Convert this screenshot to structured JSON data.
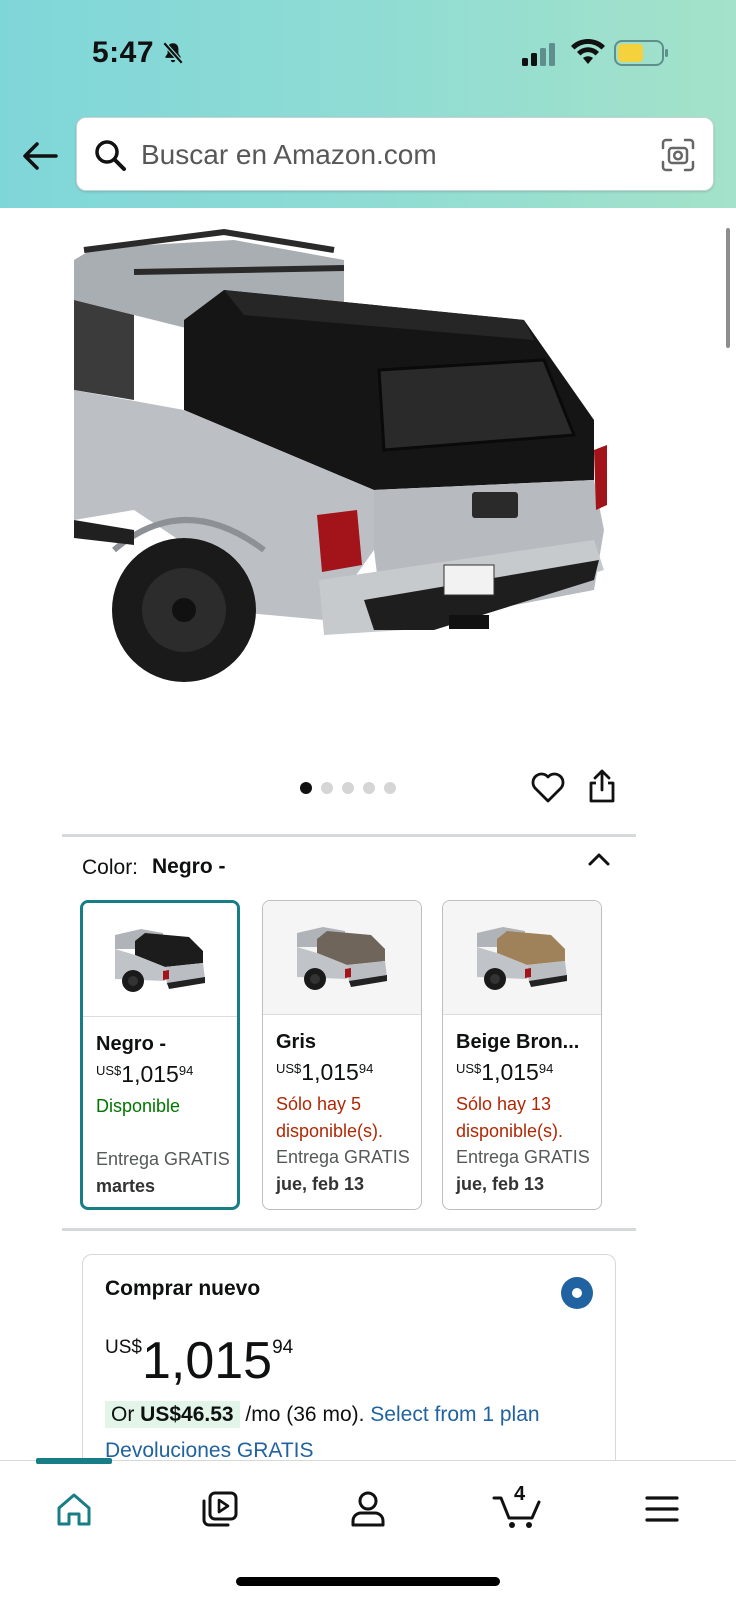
{
  "status_bar": {
    "time": "5:47",
    "icons": [
      "bell-slash-icon",
      "signal-icon",
      "wifi-icon",
      "battery-icon"
    ]
  },
  "header": {
    "back_icon": "arrow-left-icon",
    "search_placeholder": "Buscar en Amazon.com",
    "search_icon": "search-icon",
    "camera_icon": "camera-scan-icon"
  },
  "gallery": {
    "image_count": 5,
    "active_index": 0,
    "actions": [
      "heart-icon",
      "share-icon"
    ]
  },
  "color_selector": {
    "label": "Color:",
    "selected": "Negro -",
    "options": [
      {
        "name": "Negro -",
        "currency": "US$",
        "price_whole": "1,015",
        "price_fraction": "94",
        "availability": "Disponible",
        "availability_status": "in-stock",
        "delivery_label": "Entrega GRATIS",
        "delivery_date": "martes",
        "topper_color": "#1c1c1c"
      },
      {
        "name": "Gris",
        "currency": "US$",
        "price_whole": "1,015",
        "price_fraction": "94",
        "availability": "Sólo hay 5 disponible(s).",
        "availability_status": "low-stock",
        "delivery_label": "Entrega GRATIS",
        "delivery_date": "jue, feb 13",
        "topper_color": "#6f655b"
      },
      {
        "name": "Beige Bron...",
        "currency": "US$",
        "price_whole": "1,015",
        "price_fraction": "94",
        "availability": "Sólo hay 13 disponible(s).",
        "availability_status": "low-stock",
        "delivery_label": "Entrega GRATIS",
        "delivery_date": "jue, feb 13",
        "topper_color": "#a0825a"
      }
    ]
  },
  "buy_box": {
    "title": "Comprar nuevo",
    "currency": "US$",
    "price_whole": "1,015",
    "price_fraction": "94",
    "financing_prefix": "Or",
    "financing_amount": "US$46.53",
    "financing_term": "/mo (36 mo).",
    "financing_link": "Select from 1 plan",
    "returns": "Devoluciones GRATIS"
  },
  "bottom_nav": {
    "items": [
      "home-icon",
      "video-icon",
      "account-icon",
      "cart-icon",
      "menu-icon"
    ],
    "cart_count": "4",
    "active": "home"
  },
  "colors": {
    "accent_teal": "#177d86",
    "link_blue": "#2162a1",
    "in_stock_green": "#007600",
    "low_stock_red": "#b12704"
  }
}
